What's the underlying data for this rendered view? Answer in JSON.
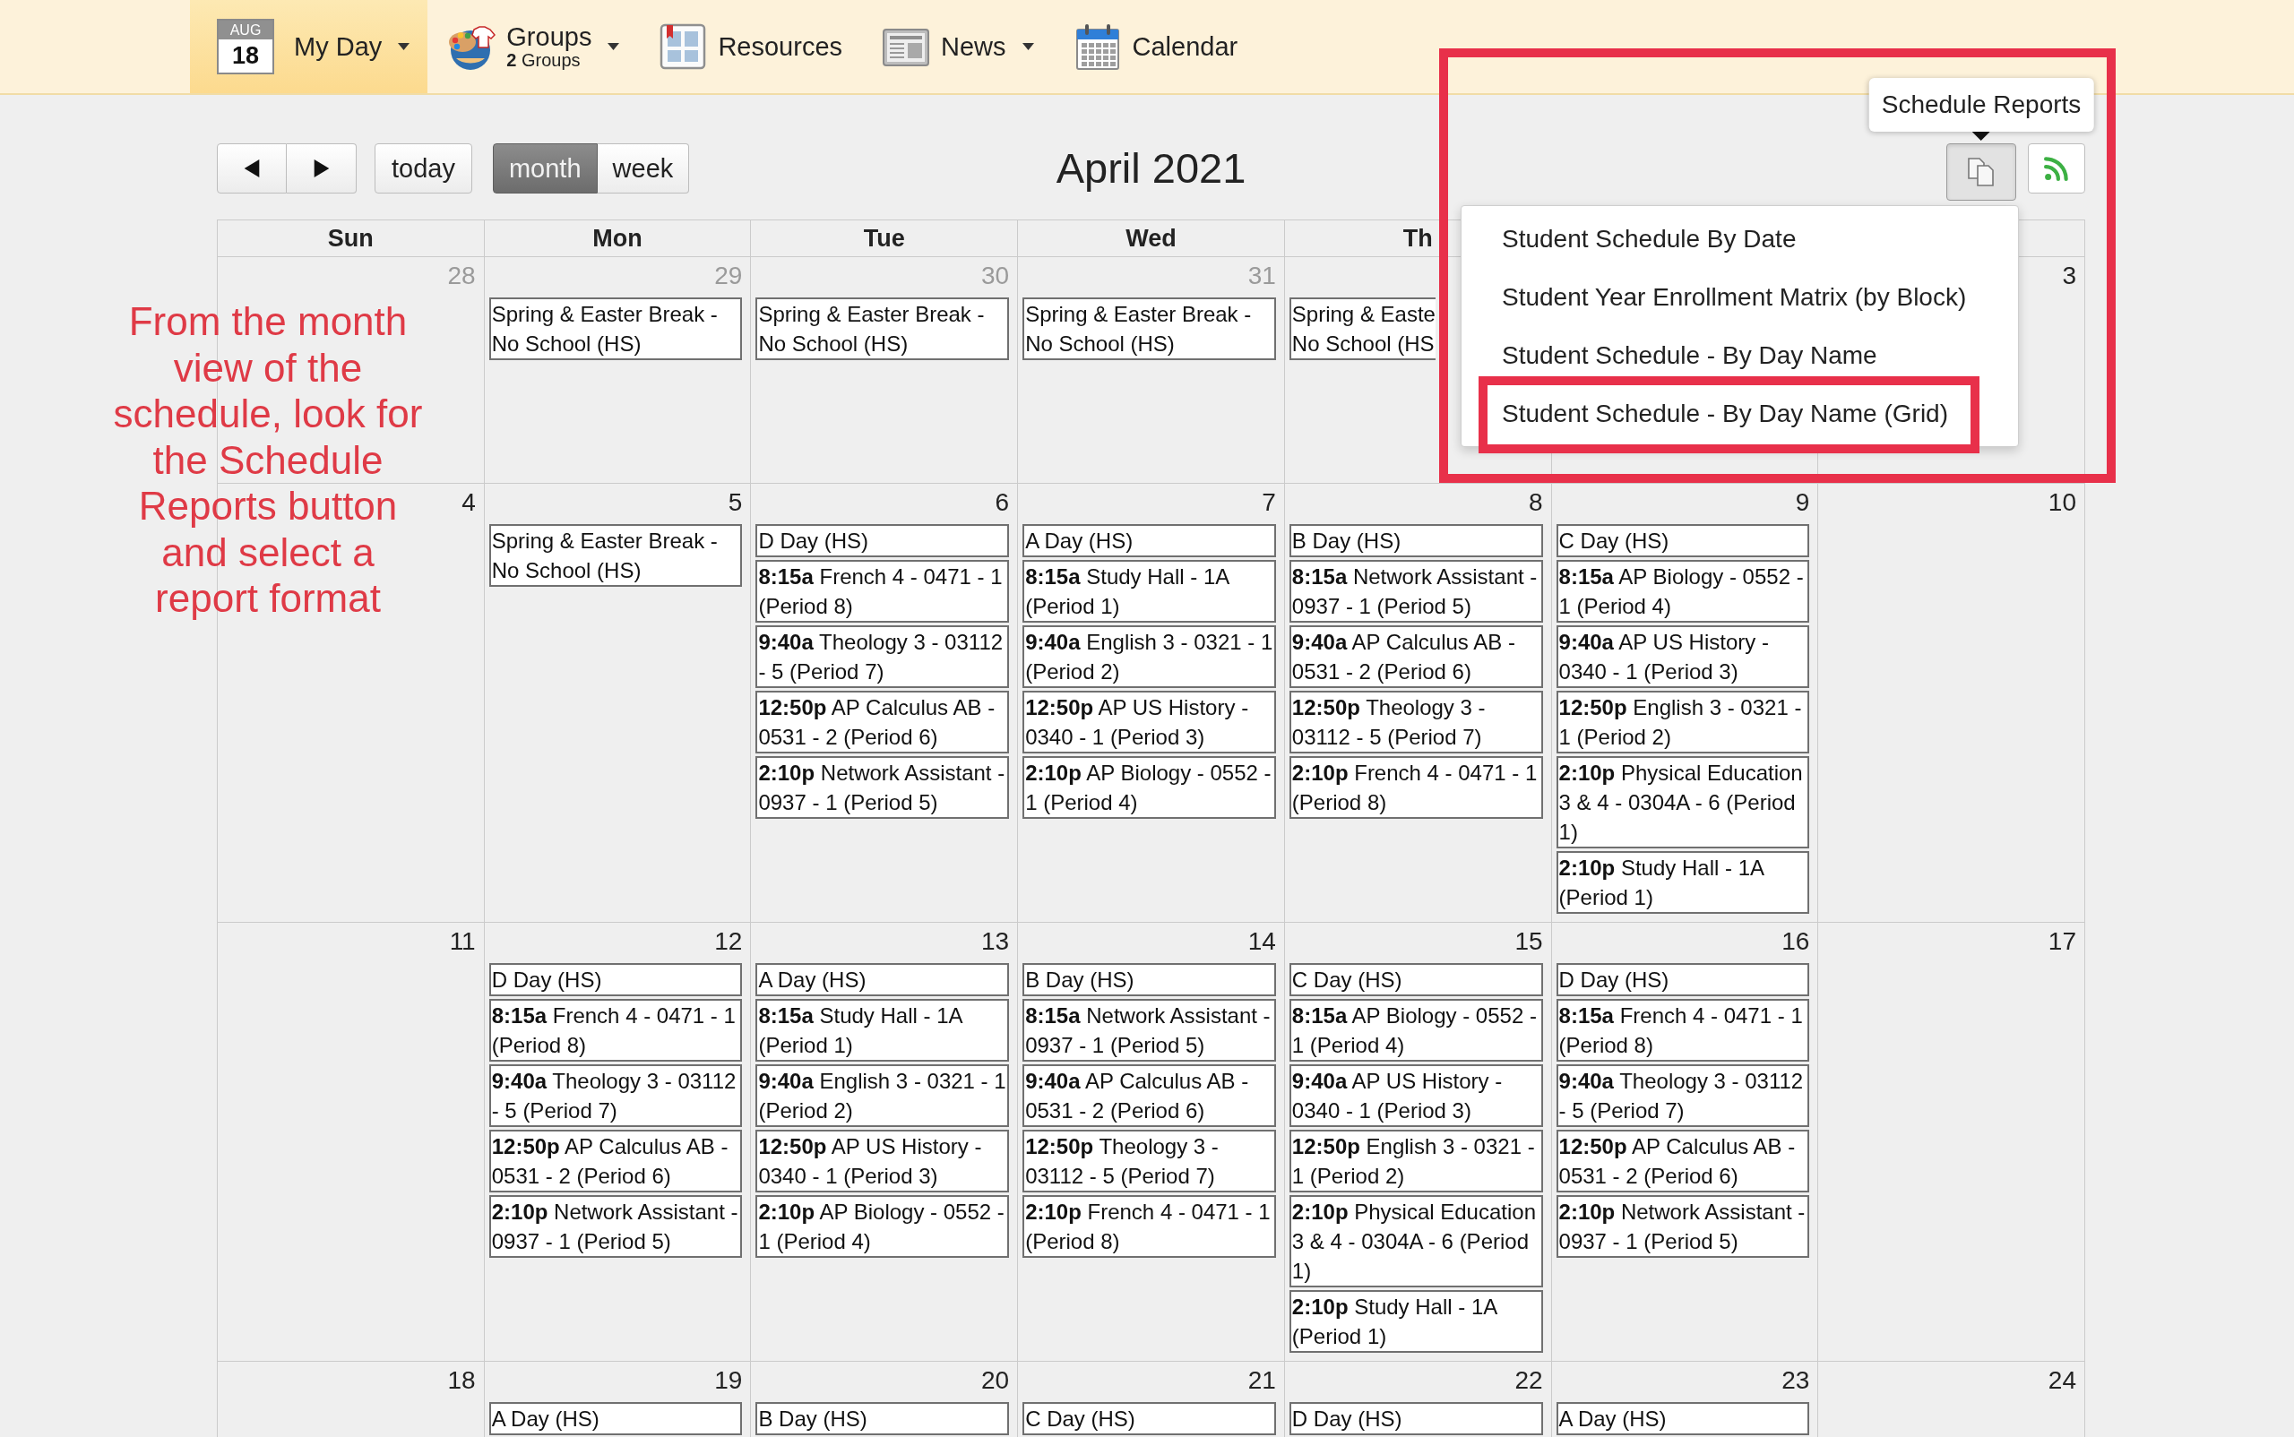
{
  "nav": {
    "items": [
      {
        "kind": "my-day",
        "badge_month": "AUG",
        "badge_day": "18",
        "label": "My Day",
        "dropdown": true,
        "selected": true
      },
      {
        "kind": "groups",
        "label": "Groups",
        "sublabel": "**2** Groups",
        "dropdown": true,
        "selected": false
      },
      {
        "kind": "resources",
        "label": "Resources",
        "dropdown": false,
        "selected": false
      },
      {
        "kind": "news",
        "label": "News",
        "dropdown": true,
        "selected": false
      },
      {
        "kind": "calendar",
        "label": "Calendar",
        "dropdown": false,
        "selected": false
      }
    ]
  },
  "toolbar": {
    "today": "today",
    "views": [
      {
        "label": "month",
        "selected": true
      },
      {
        "label": "week",
        "selected": false
      }
    ],
    "title": "April 2021"
  },
  "reports": {
    "tooltip": "Schedule Reports",
    "open": true,
    "items": [
      {
        "label": "Student Schedule By Date",
        "highlighted": false
      },
      {
        "label": "Student Year Enrollment Matrix (by Block)",
        "highlighted": false
      },
      {
        "label": "Student Schedule - By Day Name",
        "highlighted": false
      },
      {
        "label": "Student Schedule - By Day Name (Grid)",
        "highlighted": true
      }
    ]
  },
  "calendar": {
    "weekdays": [
      "Sun",
      "Mon",
      "Tue",
      "Wed",
      "Th"
    ],
    "weeks": [
      {
        "days": [
          {
            "date": "28",
            "outside_month": true
          },
          {
            "date": "29",
            "outside_month": true,
            "events": [
              {
                "title": "Spring & Easter Break - No School (HS)"
              }
            ]
          },
          {
            "date": "30",
            "outside_month": true,
            "events": [
              {
                "title": "Spring & Easter Break - No School (HS)"
              }
            ]
          },
          {
            "date": "31",
            "outside_month": true,
            "events": [
              {
                "title": "Spring & Easter Break - No School (HS)"
              }
            ]
          },
          {
            "events": [
              {
                "lines": [
                  "Spring & Easte",
                  "No School (HS"
                ]
              }
            ]
          },
          {
            "date": "3",
            "outside_month": false
          }
        ]
      },
      {
        "days": [
          {
            "date": "4",
            "outside_month": false
          },
          {
            "date": "5",
            "outside_month": false,
            "events": [
              {
                "title": "Spring & Easter Break - No School (HS)"
              }
            ]
          },
          {
            "date": "6",
            "outside_month": false,
            "events": [
              {
                "title": "D Day (HS)"
              },
              {
                "time": "8:15a",
                "title": "French 4 - 0471 - 1 (Period 8)"
              },
              {
                "time": "9:40a",
                "title": "Theology 3 - 03112 - 5 (Period 7)"
              },
              {
                "time": "12:50p",
                "title": "AP Calculus AB - 0531 - 2 (Period 6)"
              },
              {
                "time": "2:10p",
                "title": "Network Assistant - 0937 - 1 (Period 5)"
              }
            ]
          },
          {
            "date": "7",
            "outside_month": false,
            "events": [
              {
                "title": "A Day (HS)"
              },
              {
                "time": "8:15a",
                "title": "Study Hall - 1A (Period 1)"
              },
              {
                "time": "9:40a",
                "title": "English 3 - 0321 - 1 (Period 2)"
              },
              {
                "time": "12:50p",
                "title": "AP US History - 0340 - 1 (Period 3)"
              },
              {
                "time": "2:10p",
                "title": "AP Biology - 0552 - 1 (Period 4)"
              }
            ]
          },
          {
            "date": "8",
            "outside_month": false,
            "events": [
              {
                "title": "B Day (HS)"
              },
              {
                "time": "8:15a",
                "title": "Network Assistant - 0937 - 1 (Period 5)"
              },
              {
                "time": "9:40a",
                "title": "AP Calculus AB - 0531 - 2 (Period 6)"
              },
              {
                "time": "12:50p",
                "title": "Theology 3 - 03112 - 5 (Period 7)"
              },
              {
                "time": "2:10p",
                "title": "French 4 - 0471 - 1 (Period 8)"
              }
            ]
          },
          {
            "date": "9",
            "outside_month": false,
            "events": [
              {
                "title": "C Day (HS)"
              },
              {
                "time": "8:15a",
                "title": "AP Biology - 0552 - 1 (Period 4)"
              },
              {
                "time": "9:40a",
                "title": "AP US History - 0340 - 1 (Period 3)"
              },
              {
                "time": "12:50p",
                "title": "English 3 - 0321 - 1 (Period 2)"
              },
              {
                "time": "2:10p",
                "title": "Physical Education 3 & 4 - 0304A - 6 (Period 1)"
              },
              {
                "time": "2:10p",
                "title": "Study Hall - 1A (Period 1)"
              }
            ]
          },
          {
            "date": "10",
            "outside_month": false
          }
        ]
      },
      {
        "days": [
          {
            "date": "11",
            "outside_month": false
          },
          {
            "date": "12",
            "outside_month": false,
            "events": [
              {
                "title": "D Day (HS)"
              },
              {
                "time": "8:15a",
                "title": "French 4 - 0471 - 1 (Period 8)"
              },
              {
                "time": "9:40a",
                "title": "Theology 3 - 03112 - 5 (Period 7)"
              },
              {
                "time": "12:50p",
                "title": "AP Calculus AB - 0531 - 2 (Period 6)"
              },
              {
                "time": "2:10p",
                "title": "Network Assistant - 0937 - 1 (Period 5)"
              }
            ]
          },
          {
            "date": "13",
            "outside_month": false,
            "events": [
              {
                "title": "A Day (HS)"
              },
              {
                "time": "8:15a",
                "title": "Study Hall - 1A (Period 1)"
              },
              {
                "time": "9:40a",
                "title": "English 3 - 0321 - 1 (Period 2)"
              },
              {
                "time": "12:50p",
                "title": "AP US History - 0340 - 1 (Period 3)"
              },
              {
                "time": "2:10p",
                "title": "AP Biology - 0552 - 1 (Period 4)"
              }
            ]
          },
          {
            "date": "14",
            "outside_month": false,
            "events": [
              {
                "title": "B Day (HS)"
              },
              {
                "time": "8:15a",
                "title": "Network Assistant - 0937 - 1 (Period 5)"
              },
              {
                "time": "9:40a",
                "title": "AP Calculus AB - 0531 - 2 (Period 6)"
              },
              {
                "time": "12:50p",
                "title": "Theology 3 - 03112 - 5 (Period 7)"
              },
              {
                "time": "2:10p",
                "title": "French 4 - 0471 - 1 (Period 8)"
              }
            ]
          },
          {
            "date": "15",
            "outside_month": false,
            "events": [
              {
                "title": "C Day (HS)"
              },
              {
                "time": "8:15a",
                "title": "AP Biology - 0552 - 1 (Period 4)"
              },
              {
                "time": "9:40a",
                "title": "AP US History - 0340 - 1 (Period 3)"
              },
              {
                "time": "12:50p",
                "title": "English 3 - 0321 - 1 (Period 2)"
              },
              {
                "time": "2:10p",
                "title": "Physical Education 3 & 4 - 0304A - 6 (Period 1)"
              },
              {
                "time": "2:10p",
                "title": "Study Hall - 1A (Period 1)"
              }
            ]
          },
          {
            "date": "16",
            "outside_month": false,
            "events": [
              {
                "title": "D Day (HS)"
              },
              {
                "time": "8:15a",
                "title": "French 4 - 0471 - 1 (Period 8)"
              },
              {
                "time": "9:40a",
                "title": "Theology 3 - 03112 - 5 (Period 7)"
              },
              {
                "time": "12:50p",
                "title": "AP Calculus AB - 0531 - 2 (Period 6)"
              },
              {
                "time": "2:10p",
                "title": "Network Assistant - 0937 - 1 (Period 5)"
              }
            ]
          },
          {
            "date": "17",
            "outside_month": false
          }
        ]
      },
      {
        "days": [
          {
            "date": "18",
            "outside_month": false
          },
          {
            "date": "19",
            "outside_month": false,
            "events": [
              {
                "title": "A Day (HS)"
              }
            ]
          },
          {
            "date": "20",
            "outside_month": false,
            "events": [
              {
                "title": "B Day (HS)"
              }
            ]
          },
          {
            "date": "21",
            "outside_month": false,
            "events": [
              {
                "title": "C Day (HS)"
              }
            ]
          },
          {
            "date": "22",
            "outside_month": false,
            "events": [
              {
                "title": "D Day (HS)"
              }
            ]
          },
          {
            "date": "23",
            "outside_month": false,
            "events": [
              {
                "title": "A Day (HS)"
              }
            ]
          },
          {
            "date": "24",
            "outside_month": false
          }
        ]
      }
    ]
  },
  "annotation": {
    "text": "From the month view of the schedule, look for the Schedule Reports button and select a report format"
  }
}
